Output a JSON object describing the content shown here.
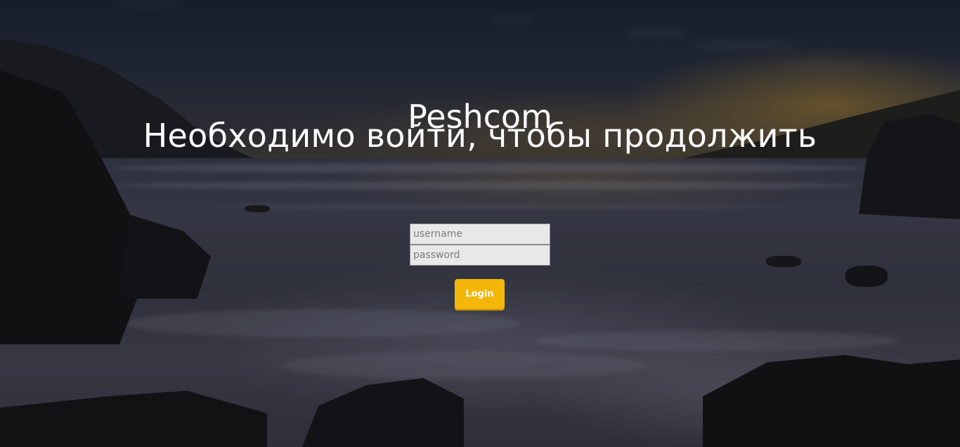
{
  "header": {
    "title": "Peshcom",
    "subtitle": "Необходимо войти, чтобы продолжить"
  },
  "login_form": {
    "username": {
      "value": "",
      "placeholder": "username"
    },
    "password": {
      "value": "",
      "placeholder": "password"
    },
    "submit_label": "Login"
  },
  "colors": {
    "accent": "#f5b60a",
    "heading_text": "#ffffff",
    "input_background": "#e8e8e8"
  }
}
